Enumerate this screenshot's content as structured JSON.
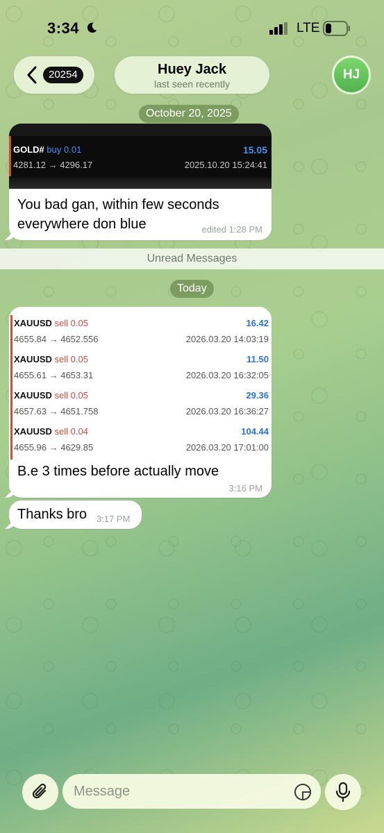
{
  "status_bar": {
    "time": "3:34",
    "network": "LTE",
    "icons": [
      "moon-icon",
      "signal-icon",
      "battery-icon"
    ]
  },
  "header": {
    "back_count": "20254",
    "contact_name": "Huey Jack",
    "contact_status": "last seen recently",
    "avatar_initials": "HJ",
    "avatar_color": "#5bbd57"
  },
  "chat": {
    "date_chip_1": "October 20, 2025",
    "message_1": {
      "trade": {
        "symbol": "GOLD#",
        "side": "buy 0.01",
        "pnl": "15.05",
        "prices": "4281.12 → 4296.17",
        "datetime": "2025.10.20 15:24:41"
      },
      "text": "You bad gan, within few seconds everywhere don blue",
      "time": "edited 1:28 PM"
    },
    "unread_label": "Unread Messages",
    "date_chip_2": "Today",
    "message_2": {
      "trades": [
        {
          "symbol": "XAUUSD",
          "side": "sell 0.05",
          "pnl": "16.42",
          "prices": "4655.84 → 4652.556",
          "datetime": "2026.03.20 14:03:19"
        },
        {
          "symbol": "XAUUSD",
          "side": "sell 0.05",
          "pnl": "11.50",
          "prices": "4655.61 → 4653.31",
          "datetime": "2026.03.20 16:32:05"
        },
        {
          "symbol": "XAUUSD",
          "side": "sell 0.05",
          "pnl": "29.36",
          "prices": "4657.63 → 4651.758",
          "datetime": "2026.03.20 16:36:27"
        },
        {
          "symbol": "XAUUSD",
          "side": "sell 0.04",
          "pnl": "104.44",
          "prices": "4655.96 → 4629.85",
          "datetime": "2026.03.20 17:01:00"
        }
      ],
      "text": "B.e 3 times before actually move",
      "time": "3:16 PM"
    },
    "message_3": {
      "text": "Thanks bro",
      "time": "3:17 PM"
    }
  },
  "composer": {
    "placeholder": "Message"
  },
  "colors": {
    "sell": "#d24a3c",
    "buy": "#4d8ff0",
    "profit": "#2b73d4"
  }
}
